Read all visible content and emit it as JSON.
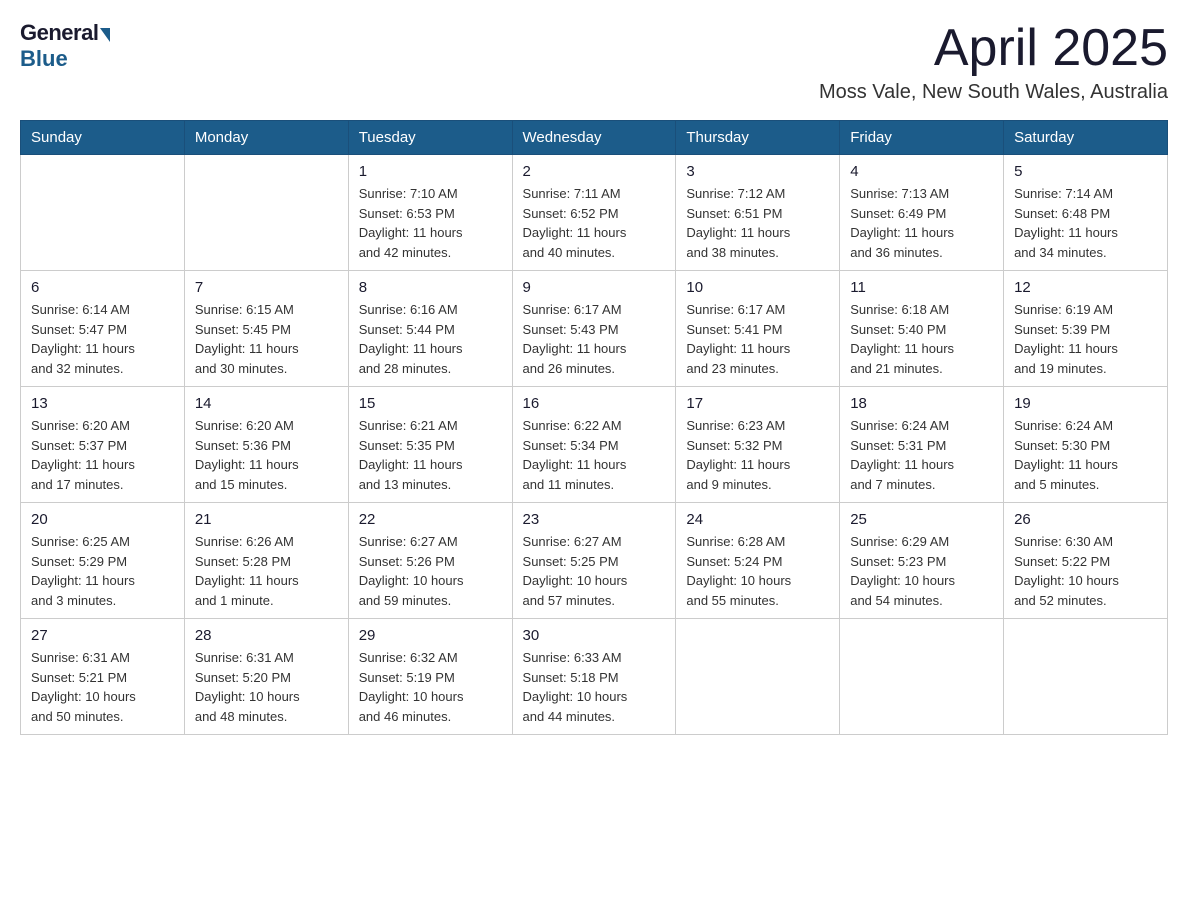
{
  "logo": {
    "general": "General",
    "blue": "Blue"
  },
  "title": "April 2025",
  "location": "Moss Vale, New South Wales, Australia",
  "days_of_week": [
    "Sunday",
    "Monday",
    "Tuesday",
    "Wednesday",
    "Thursday",
    "Friday",
    "Saturday"
  ],
  "weeks": [
    [
      {
        "day": "",
        "info": ""
      },
      {
        "day": "",
        "info": ""
      },
      {
        "day": "1",
        "info": "Sunrise: 7:10 AM\nSunset: 6:53 PM\nDaylight: 11 hours\nand 42 minutes."
      },
      {
        "day": "2",
        "info": "Sunrise: 7:11 AM\nSunset: 6:52 PM\nDaylight: 11 hours\nand 40 minutes."
      },
      {
        "day": "3",
        "info": "Sunrise: 7:12 AM\nSunset: 6:51 PM\nDaylight: 11 hours\nand 38 minutes."
      },
      {
        "day": "4",
        "info": "Sunrise: 7:13 AM\nSunset: 6:49 PM\nDaylight: 11 hours\nand 36 minutes."
      },
      {
        "day": "5",
        "info": "Sunrise: 7:14 AM\nSunset: 6:48 PM\nDaylight: 11 hours\nand 34 minutes."
      }
    ],
    [
      {
        "day": "6",
        "info": "Sunrise: 6:14 AM\nSunset: 5:47 PM\nDaylight: 11 hours\nand 32 minutes."
      },
      {
        "day": "7",
        "info": "Sunrise: 6:15 AM\nSunset: 5:45 PM\nDaylight: 11 hours\nand 30 minutes."
      },
      {
        "day": "8",
        "info": "Sunrise: 6:16 AM\nSunset: 5:44 PM\nDaylight: 11 hours\nand 28 minutes."
      },
      {
        "day": "9",
        "info": "Sunrise: 6:17 AM\nSunset: 5:43 PM\nDaylight: 11 hours\nand 26 minutes."
      },
      {
        "day": "10",
        "info": "Sunrise: 6:17 AM\nSunset: 5:41 PM\nDaylight: 11 hours\nand 23 minutes."
      },
      {
        "day": "11",
        "info": "Sunrise: 6:18 AM\nSunset: 5:40 PM\nDaylight: 11 hours\nand 21 minutes."
      },
      {
        "day": "12",
        "info": "Sunrise: 6:19 AM\nSunset: 5:39 PM\nDaylight: 11 hours\nand 19 minutes."
      }
    ],
    [
      {
        "day": "13",
        "info": "Sunrise: 6:20 AM\nSunset: 5:37 PM\nDaylight: 11 hours\nand 17 minutes."
      },
      {
        "day": "14",
        "info": "Sunrise: 6:20 AM\nSunset: 5:36 PM\nDaylight: 11 hours\nand 15 minutes."
      },
      {
        "day": "15",
        "info": "Sunrise: 6:21 AM\nSunset: 5:35 PM\nDaylight: 11 hours\nand 13 minutes."
      },
      {
        "day": "16",
        "info": "Sunrise: 6:22 AM\nSunset: 5:34 PM\nDaylight: 11 hours\nand 11 minutes."
      },
      {
        "day": "17",
        "info": "Sunrise: 6:23 AM\nSunset: 5:32 PM\nDaylight: 11 hours\nand 9 minutes."
      },
      {
        "day": "18",
        "info": "Sunrise: 6:24 AM\nSunset: 5:31 PM\nDaylight: 11 hours\nand 7 minutes."
      },
      {
        "day": "19",
        "info": "Sunrise: 6:24 AM\nSunset: 5:30 PM\nDaylight: 11 hours\nand 5 minutes."
      }
    ],
    [
      {
        "day": "20",
        "info": "Sunrise: 6:25 AM\nSunset: 5:29 PM\nDaylight: 11 hours\nand 3 minutes."
      },
      {
        "day": "21",
        "info": "Sunrise: 6:26 AM\nSunset: 5:28 PM\nDaylight: 11 hours\nand 1 minute."
      },
      {
        "day": "22",
        "info": "Sunrise: 6:27 AM\nSunset: 5:26 PM\nDaylight: 10 hours\nand 59 minutes."
      },
      {
        "day": "23",
        "info": "Sunrise: 6:27 AM\nSunset: 5:25 PM\nDaylight: 10 hours\nand 57 minutes."
      },
      {
        "day": "24",
        "info": "Sunrise: 6:28 AM\nSunset: 5:24 PM\nDaylight: 10 hours\nand 55 minutes."
      },
      {
        "day": "25",
        "info": "Sunrise: 6:29 AM\nSunset: 5:23 PM\nDaylight: 10 hours\nand 54 minutes."
      },
      {
        "day": "26",
        "info": "Sunrise: 6:30 AM\nSunset: 5:22 PM\nDaylight: 10 hours\nand 52 minutes."
      }
    ],
    [
      {
        "day": "27",
        "info": "Sunrise: 6:31 AM\nSunset: 5:21 PM\nDaylight: 10 hours\nand 50 minutes."
      },
      {
        "day": "28",
        "info": "Sunrise: 6:31 AM\nSunset: 5:20 PM\nDaylight: 10 hours\nand 48 minutes."
      },
      {
        "day": "29",
        "info": "Sunrise: 6:32 AM\nSunset: 5:19 PM\nDaylight: 10 hours\nand 46 minutes."
      },
      {
        "day": "30",
        "info": "Sunrise: 6:33 AM\nSunset: 5:18 PM\nDaylight: 10 hours\nand 44 minutes."
      },
      {
        "day": "",
        "info": ""
      },
      {
        "day": "",
        "info": ""
      },
      {
        "day": "",
        "info": ""
      }
    ]
  ]
}
